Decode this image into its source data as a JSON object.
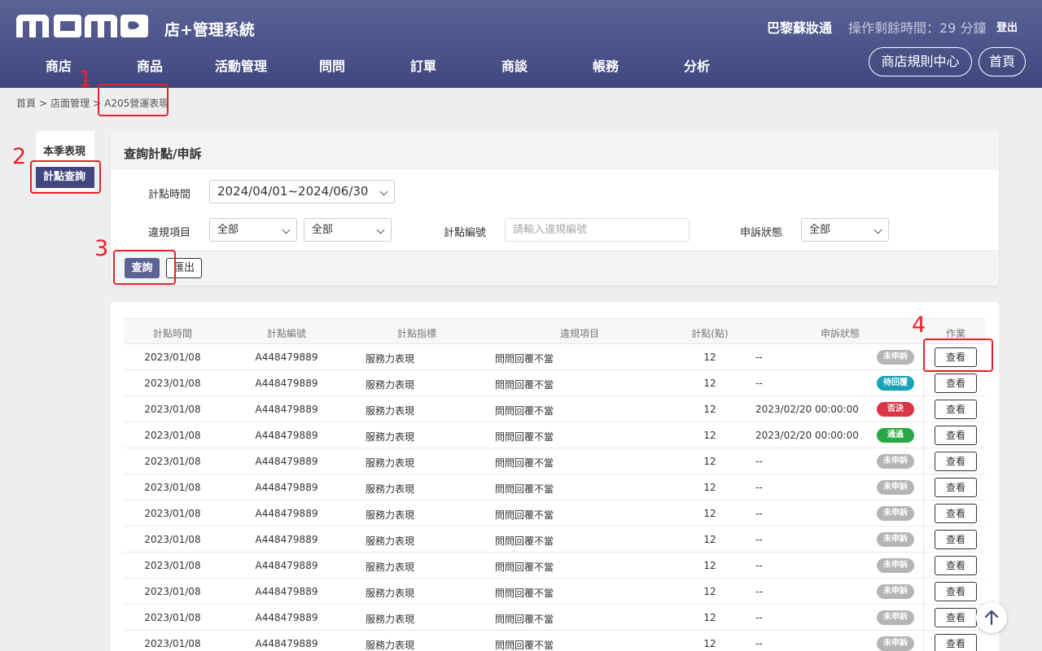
{
  "header": {
    "logo": "MOMO",
    "system_title": "店+管理系統",
    "user_name": "巴黎蘇妝通",
    "session_timer": "操作剩餘時間：29 分鐘",
    "logout": "登出",
    "nav": [
      "商店",
      "商品",
      "活動管理",
      "問問",
      "訂單",
      "商談",
      "帳務",
      "分析"
    ],
    "rules_center": "商店規則中心",
    "home": "首頁"
  },
  "breadcrumb": [
    "首頁",
    "店面管理",
    "A205營運表現"
  ],
  "breadcrumb_separator": ">",
  "side_tabs": [
    "本季表現",
    "計點查詢"
  ],
  "query_panel": {
    "title": "查詢計點/申訴",
    "period_label": "計點時間",
    "period_value": "2024/04/01~2024/06/30",
    "violation_label": "違規項目",
    "violation_value_1": "全部",
    "violation_value_2": "全部",
    "code_label": "計點編號",
    "code_placeholder": "請輸入違規編號",
    "appeal_label": "申訴狀態",
    "appeal_value": "全部",
    "query_button": "查詢",
    "export_button": "匯出"
  },
  "table": {
    "headers": [
      "計點時間",
      "計點編號",
      "計點指標",
      "違規項目",
      "計點(點)",
      "申訴狀態",
      "作業"
    ],
    "view_label": "查看",
    "rows": [
      {
        "date": "2023/01/08",
        "code": "A448479889",
        "indicator": "服務力表現",
        "item": "問問回覆不當",
        "points": "12",
        "status_time": "--",
        "badge": "未申訴",
        "badge_color": "#b5b5b5"
      },
      {
        "date": "2023/01/08",
        "code": "A448479889",
        "indicator": "服務力表現",
        "item": "問問回覆不當",
        "points": "12",
        "status_time": "--",
        "badge": "待回覆",
        "badge_color": "#1aa3b8"
      },
      {
        "date": "2023/01/08",
        "code": "A448479889",
        "indicator": "服務力表現",
        "item": "問問回覆不當",
        "points": "12",
        "status_time": "2023/02/20 00:00:00",
        "badge": "否決",
        "badge_color": "#dc3545"
      },
      {
        "date": "2023/01/08",
        "code": "A448479889",
        "indicator": "服務力表現",
        "item": "問問回覆不當",
        "points": "12",
        "status_time": "2023/02/20 00:00:00",
        "badge": "通過",
        "badge_color": "#28a745"
      },
      {
        "date": "2023/01/08",
        "code": "A448479889",
        "indicator": "服務力表現",
        "item": "問問回覆不當",
        "points": "12",
        "status_time": "--",
        "badge": "未申訴",
        "badge_color": "#b5b5b5"
      },
      {
        "date": "2023/01/08",
        "code": "A448479889",
        "indicator": "服務力表現",
        "item": "問問回覆不當",
        "points": "12",
        "status_time": "--",
        "badge": "未申訴",
        "badge_color": "#b5b5b5"
      },
      {
        "date": "2023/01/08",
        "code": "A448479889",
        "indicator": "服務力表現",
        "item": "問問回覆不當",
        "points": "12",
        "status_time": "--",
        "badge": "未申訴",
        "badge_color": "#b5b5b5"
      },
      {
        "date": "2023/01/08",
        "code": "A448479889",
        "indicator": "服務力表現",
        "item": "問問回覆不當",
        "points": "12",
        "status_time": "--",
        "badge": "未申訴",
        "badge_color": "#b5b5b5"
      },
      {
        "date": "2023/01/08",
        "code": "A448479889",
        "indicator": "服務力表現",
        "item": "問問回覆不當",
        "points": "12",
        "status_time": "--",
        "badge": "未申訴",
        "badge_color": "#b5b5b5"
      },
      {
        "date": "2023/01/08",
        "code": "A448479889",
        "indicator": "服務力表現",
        "item": "問問回覆不當",
        "points": "12",
        "status_time": "--",
        "badge": "未申訴",
        "badge_color": "#b5b5b5"
      },
      {
        "date": "2023/01/08",
        "code": "A448479889",
        "indicator": "服務力表現",
        "item": "問問回覆不當",
        "points": "12",
        "status_time": "--",
        "badge": "未申訴",
        "badge_color": "#b5b5b5"
      },
      {
        "date": "2023/01/08",
        "code": "A448479889",
        "indicator": "服務力表現",
        "item": "問問回覆不當",
        "points": "12",
        "status_time": "--",
        "badge": "未申訴",
        "badge_color": "#b5b5b5"
      }
    ]
  },
  "annotations": [
    "1",
    "2",
    "3",
    "4"
  ],
  "colors": {
    "header_top": "#5a6296",
    "header_bottom": "#3f477e",
    "annotation_red": "#e8222a",
    "primary_button": "#5a6296"
  },
  "icons": {
    "scroll_top": "arrow-up-icon",
    "dropdown": "chevron-down-icon"
  }
}
